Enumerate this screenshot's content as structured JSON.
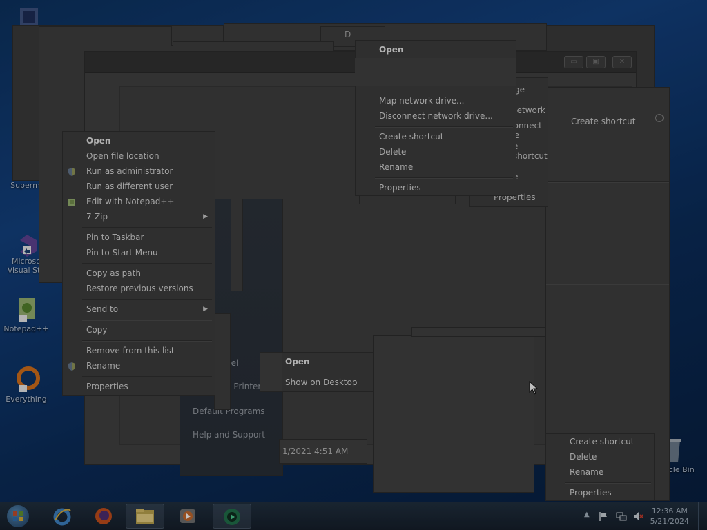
{
  "desktop": {
    "icons": [
      {
        "label": "Supermi",
        "icon": "app-icon"
      },
      {
        "label": "Microso",
        "label2": "Visual Stu",
        "icon": "visual-studio-icon"
      },
      {
        "label": "Notepad++",
        "icon": "notepad-plus-plus-icon"
      },
      {
        "label": "Everything",
        "icon": "everything-search-icon"
      },
      {
        "label": "Recycle Bin",
        "icon": "recycle-bin-icon"
      }
    ]
  },
  "main_context_menu": {
    "items": [
      {
        "label": "Open",
        "bold": true
      },
      {
        "label": "Open file location"
      },
      {
        "label": "Run as administrator",
        "icon": "uac-shield-icon"
      },
      {
        "label": "Run as different user"
      },
      {
        "label": "Edit with Notepad++",
        "icon": "notepad-plus-plus-icon"
      },
      {
        "label": "7-Zip",
        "submenu": true
      },
      {
        "label": "Pin to Taskbar"
      },
      {
        "label": "Pin to Start Menu"
      },
      {
        "label": "Copy as path"
      },
      {
        "label": "Restore previous versions"
      },
      {
        "label": "Send to",
        "submenu": true
      },
      {
        "label": "Copy"
      },
      {
        "label": "Remove from this list"
      },
      {
        "label": "Rename",
        "icon": "uac-shield-icon"
      },
      {
        "label": "Properties"
      }
    ]
  },
  "top_context_menu": {
    "title": "Open",
    "items": [
      {
        "label": "Map network drive..."
      },
      {
        "label": "Disconnect network drive..."
      },
      {
        "label": "Create shortcut"
      },
      {
        "label": "Delete"
      },
      {
        "label": "Rename"
      },
      {
        "label": "Properties"
      }
    ],
    "behind_fragments": [
      "ge",
      "network d",
      "connect ne",
      "e shortcut",
      "e",
      "Properties"
    ]
  },
  "right_menus": {
    "top_item": "Create shortcut",
    "bottom_items": [
      {
        "label": "Create shortcut"
      },
      {
        "label": "Delete"
      },
      {
        "label": "Rename"
      },
      {
        "label": "Properties"
      }
    ]
  },
  "small_menu": {
    "items": [
      {
        "label": "Open",
        "bold": true
      },
      {
        "label": "Show on Desktop"
      }
    ]
  },
  "start_menu": {
    "items": [
      "nel",
      "d Printers",
      "Default Programs",
      "Help and Support"
    ]
  },
  "explorer_fragments": {
    "date_text": "1/2021 4:51 AM",
    "letter": "D"
  },
  "taskbar": {
    "clock_time": "12:36 AM",
    "clock_date": "5/21/2024",
    "buttons": [
      "start-orb-icon",
      "internet-explorer-icon",
      "firefox-icon",
      "file-explorer-icon",
      "media-player-icon",
      "camtasia-icon"
    ]
  },
  "colors": {
    "desktop_bg": "#0f3466",
    "menu_bg": "#3a3a3a",
    "menu_text": "#c8c8c8"
  }
}
